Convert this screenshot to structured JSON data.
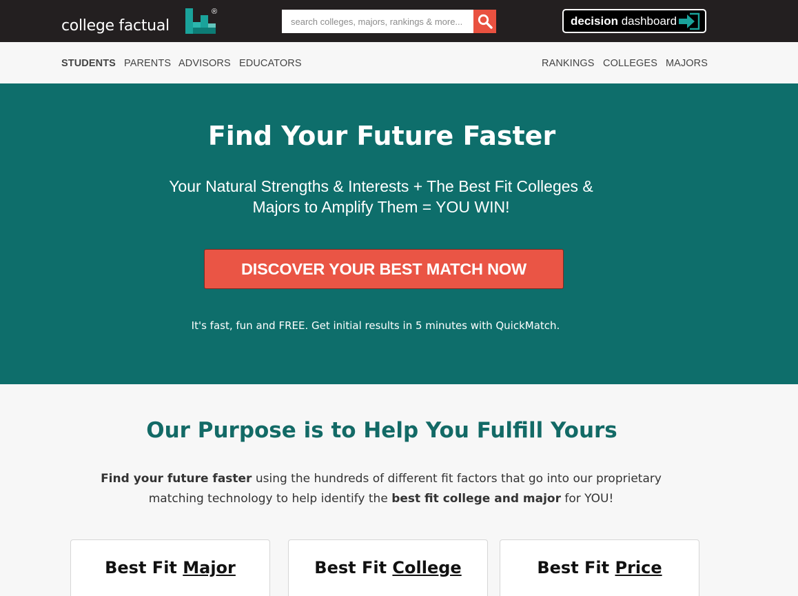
{
  "header": {
    "logo": {
      "prefix": "college ",
      "bold": "factual",
      "reg": "®"
    },
    "search": {
      "placeholder": "search colleges, majors, rankings & more..."
    },
    "dashboard": {
      "bold": "decision",
      "rest": " dashboard"
    }
  },
  "subnav": {
    "left": [
      "STUDENTS",
      "PARENTS",
      "ADVISORS",
      "EDUCATORS"
    ],
    "right": [
      "RANKINGS",
      "COLLEGES",
      "MAJORS"
    ]
  },
  "hero": {
    "title": "Find Your Future Faster",
    "subtitle_line1": "Your Natural Strengths & Interests + The Best Fit Colleges &",
    "subtitle_line2": "Majors to Amplify Them = YOU WIN!",
    "cta": "DISCOVER YOUR BEST MATCH NOW",
    "note": "It's fast, fun and FREE. Get initial results in 5 minutes with QuickMatch."
  },
  "purpose": {
    "title": "Our Purpose is to Help You Fulfill Yours",
    "p1_bold": "Find your future faster",
    "p1_rest": " using the hundreds of different fit factors that go into our proprietary",
    "p2_start": "matching technology to help identify the ",
    "p2_bold": "best fit college and major",
    "p2_end": " for YOU!"
  },
  "cards": [
    {
      "prefix": "Best Fit ",
      "link": "Major"
    },
    {
      "prefix": "Best Fit ",
      "link": "College"
    },
    {
      "prefix": "Best Fit ",
      "link": "Price"
    }
  ],
  "colors": {
    "topbar": "#231f20",
    "teal": "#0e6e6b",
    "cta": "#ea5545",
    "accent_teal": "#136a66"
  }
}
